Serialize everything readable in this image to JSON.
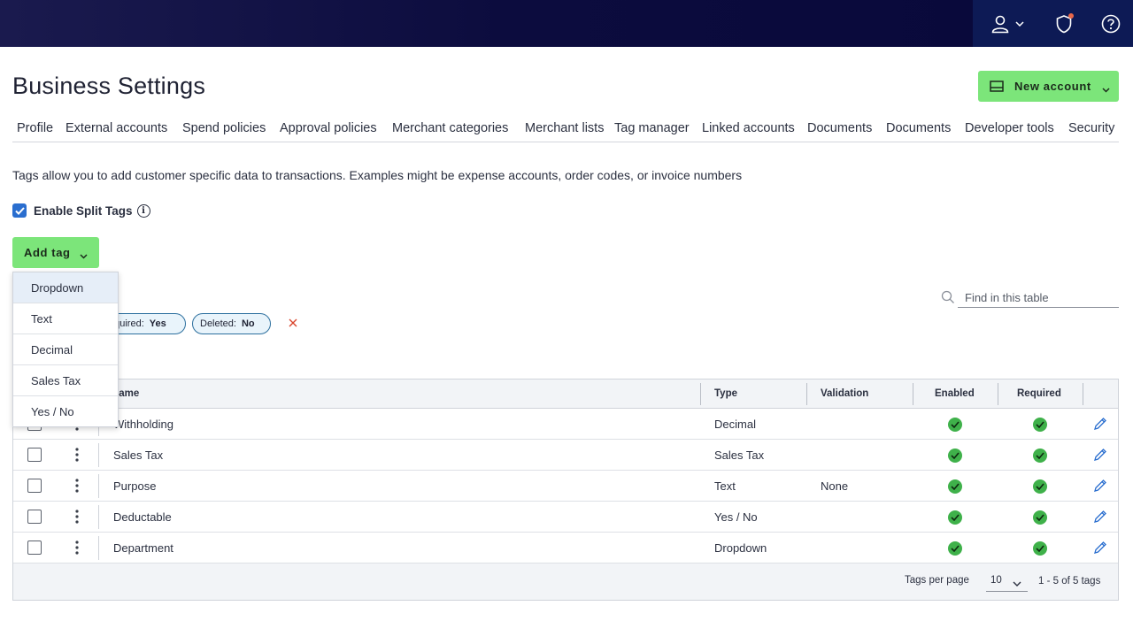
{
  "header": {
    "icons": [
      "user-icon",
      "chevron-down-icon",
      "shield-icon",
      "help-icon"
    ],
    "notification_color": "#e8674a"
  },
  "page_title": "Business Settings",
  "new_account": {
    "label": "New account",
    "icon": "card-reader-icon"
  },
  "tabs": [
    "Profile",
    "External accounts",
    "Spend policies",
    "Approval policies",
    "Merchant categories",
    "Merchant lists",
    "Tag manager",
    "Linked accounts",
    "Documents",
    "Documents",
    "Developer tools",
    "Security"
  ],
  "description": "Tags allow you to add customer specific data to transactions. Examples might be expense accounts, order codes, or invoice numbers",
  "split_tags": {
    "label": "Enable Split Tags",
    "checked": true,
    "info": "i"
  },
  "add_tag": {
    "label": "Add tag"
  },
  "add_tag_menu": [
    "Dropdown",
    "Text",
    "Decimal",
    "Sales Tax",
    "Yes / No"
  ],
  "filters": [
    {
      "label": "equired:",
      "value": "Yes"
    },
    {
      "label": "Deleted:",
      "value": "No"
    }
  ],
  "search": {
    "placeholder": "Find in this table"
  },
  "table": {
    "columns": [
      "lame",
      "Type",
      "Validation",
      "Enabled",
      "Required"
    ],
    "rows": [
      {
        "name": "Withholding",
        "type": "Decimal",
        "validation": "",
        "enabled": true,
        "required": true
      },
      {
        "name": "Sales Tax",
        "type": "Sales Tax",
        "validation": "",
        "enabled": true,
        "required": true
      },
      {
        "name": "Purpose",
        "type": "Text",
        "validation": "None",
        "enabled": true,
        "required": true
      },
      {
        "name": "Deductable",
        "type": "Yes / No",
        "validation": "",
        "enabled": true,
        "required": true
      },
      {
        "name": "Department",
        "type": "Dropdown",
        "validation": "",
        "enabled": true,
        "required": true
      }
    ],
    "footer": {
      "per_page_label": "Tags per page",
      "per_page_value": "10",
      "range": "1 - 5 of 5 tags"
    }
  },
  "colors": {
    "accent_green": "#7ce57a",
    "check_green": "#3fb14a",
    "link_blue": "#2a6ecf",
    "header_navy": "#0c0c3e"
  }
}
